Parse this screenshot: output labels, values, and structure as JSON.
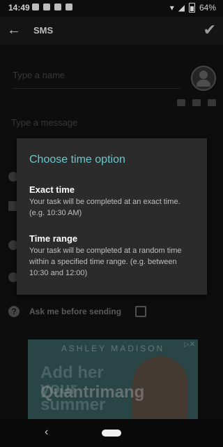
{
  "status_bar": {
    "time": "14:49",
    "battery": "64%"
  },
  "app_bar": {
    "title": "SMS"
  },
  "form": {
    "name_placeholder": "Type a name",
    "message_placeholder": "Type a message",
    "ask_label": "Ask me before sending"
  },
  "dialog": {
    "title": "Choose time option",
    "options": [
      {
        "title": "Exact time",
        "description": "Your task will be completed at an exact time. (e.g. 10:30 AM)"
      },
      {
        "title": "Time range",
        "description": "Your task will be completed at a random time within a specified time range. (e.g. between 10:30 and 12:00)"
      }
    ]
  },
  "ad": {
    "brand": "ASHLEY MADISON",
    "headline": "Add her your summer"
  },
  "watermark": "Quantrimang"
}
